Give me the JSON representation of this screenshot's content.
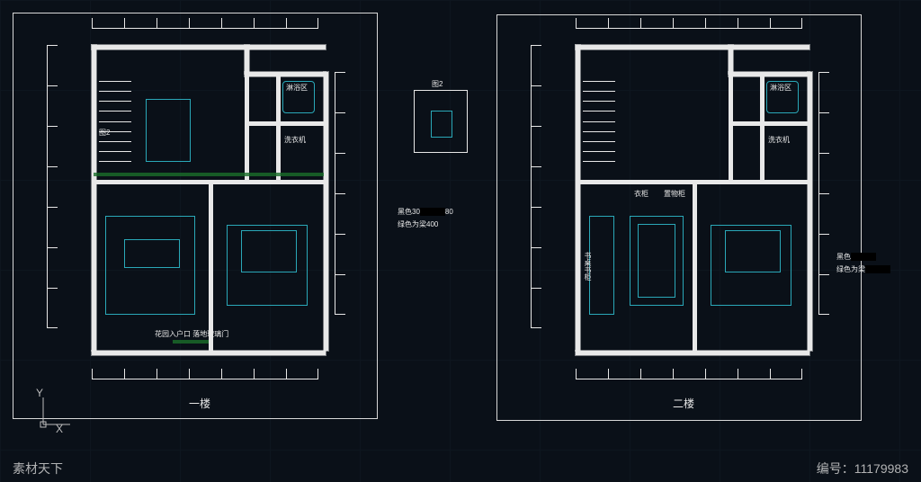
{
  "canvas": {
    "background": "#0a1018",
    "line_color": "#e8e8e8",
    "furniture_color": "#2aa8b8",
    "beam_color": "#1a6e2a"
  },
  "plans": {
    "floor1": {
      "title": "一楼",
      "rooms": {
        "bathroom": "淋浴区",
        "laundry": "洗衣机",
        "entry_note": "花园入户口\n落地玻璃门"
      },
      "marker": "图2"
    },
    "floor2": {
      "title": "二楼",
      "rooms": {
        "bathroom": "淋浴区",
        "laundry": "洗衣机",
        "desk": "书桌书柜",
        "cabinet1": "衣柜",
        "cabinet2": "置物柜"
      }
    }
  },
  "detail": {
    "title": "图2"
  },
  "legend": {
    "line1_prefix": "黑色30",
    "line1_suffix": "80",
    "line2_prefix": "绿色为梁",
    "line2_suffix": "400",
    "line3_prefix": "黑色",
    "line4_prefix": "绿色为梁"
  },
  "ucs": {
    "x": "X",
    "y": "Y"
  },
  "watermark": {
    "left": "素材天下",
    "right_label": "编号：",
    "right_id": "11179983"
  }
}
